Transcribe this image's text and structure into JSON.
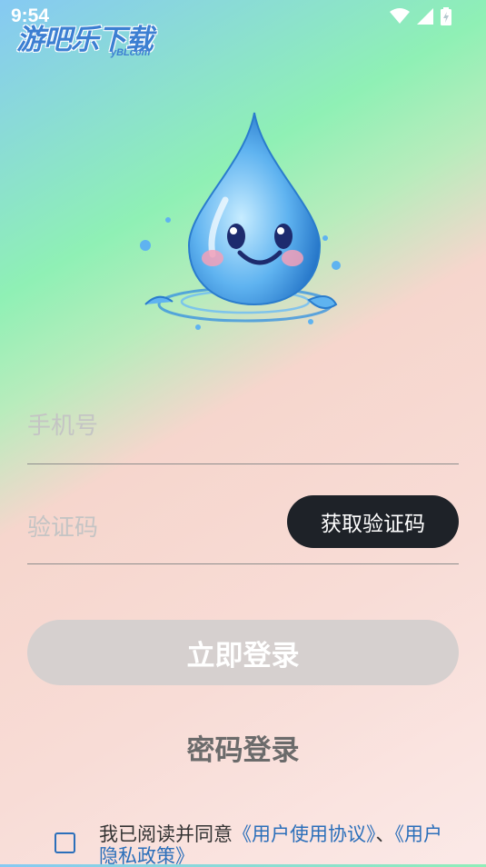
{
  "status_bar": {
    "time": "9:54"
  },
  "watermark": {
    "main": "游吧乐下载",
    "sub": "yBLcom"
  },
  "form": {
    "phone_placeholder": "手机号",
    "code_placeholder": "验证码",
    "get_code_label": "获取验证码",
    "login_label": "立即登录",
    "password_login_label": "密码登录"
  },
  "agreement": {
    "prefix": "我已阅读并同意",
    "user_agreement": "《用户使用协议》",
    "separator": "、",
    "privacy_policy": "《用户隐私政策》"
  },
  "colors": {
    "button_dark": "#1e2228",
    "button_disabled": "#d6d0cf",
    "link": "#2b6fba"
  }
}
